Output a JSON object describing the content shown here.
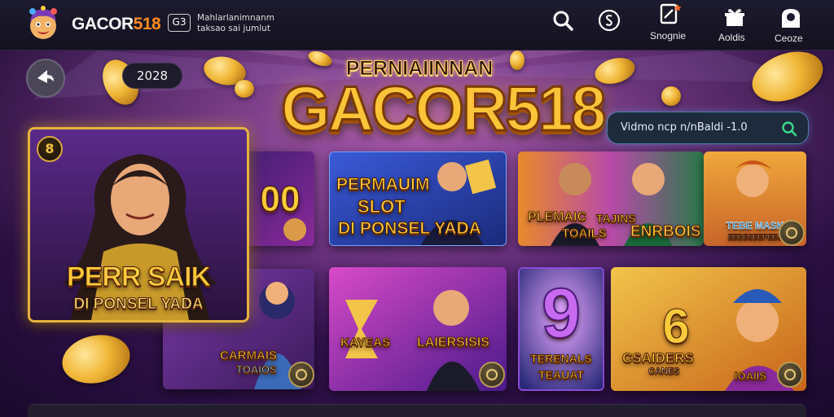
{
  "header": {
    "brand_prefix": "GACOR",
    "brand_suffix": "518",
    "tagline_badge": "G3",
    "tagline_line1": "Mahlarlanimnanm",
    "tagline_line2": "taksao sai jumlut",
    "nav": [
      {
        "label": "",
        "icon": "search-icon"
      },
      {
        "label": "",
        "icon": "dollar-circle-icon"
      },
      {
        "label": "Snognie",
        "icon": "phone-icon"
      },
      {
        "label": "Aoldis",
        "icon": "gift-icon"
      },
      {
        "label": "Ceoze",
        "icon": "profile-icon"
      }
    ]
  },
  "hero": {
    "year": "2028",
    "kicker": "PERNIAIINNAN",
    "title": "GACOR518"
  },
  "search": {
    "text": "Vidmo ncp n/nBaldi -1.0"
  },
  "cards": {
    "featured": {
      "line1": "PERR SAIK",
      "line2": "DI PONSEL YADA",
      "badge": "8"
    },
    "c1": {
      "text": "00"
    },
    "c2": {
      "line1": "PERMAUIM",
      "line2": "SLOT",
      "line3": "DI PONSEL YADA"
    },
    "c3": {
      "line1": "PLEMAIC",
      "line2": "TOAILS",
      "line3": "TAJINS",
      "line4": "ENRBOIS"
    },
    "c4": {
      "line1": "TEBE MASK",
      "line2": "EEBESEEPEES"
    },
    "c5": {
      "line1": "CARMAIS",
      "line2": "TOAIOS"
    },
    "c6": {
      "line1": "KAYEAS",
      "line2": "LAIERSISIS"
    },
    "c7": {
      "digit": "9",
      "line1": "TERENALS",
      "line2": "TEAUAT"
    },
    "c8": {
      "digit": "6",
      "line1": "CSAIDERS",
      "line2": "CANES",
      "line3": "IOAIIS"
    }
  },
  "colors": {
    "accent_gold": "#ffc437",
    "brand_orange": "#ff8a1f",
    "topbar": "#1c1a2e",
    "background": "#3a1458"
  }
}
